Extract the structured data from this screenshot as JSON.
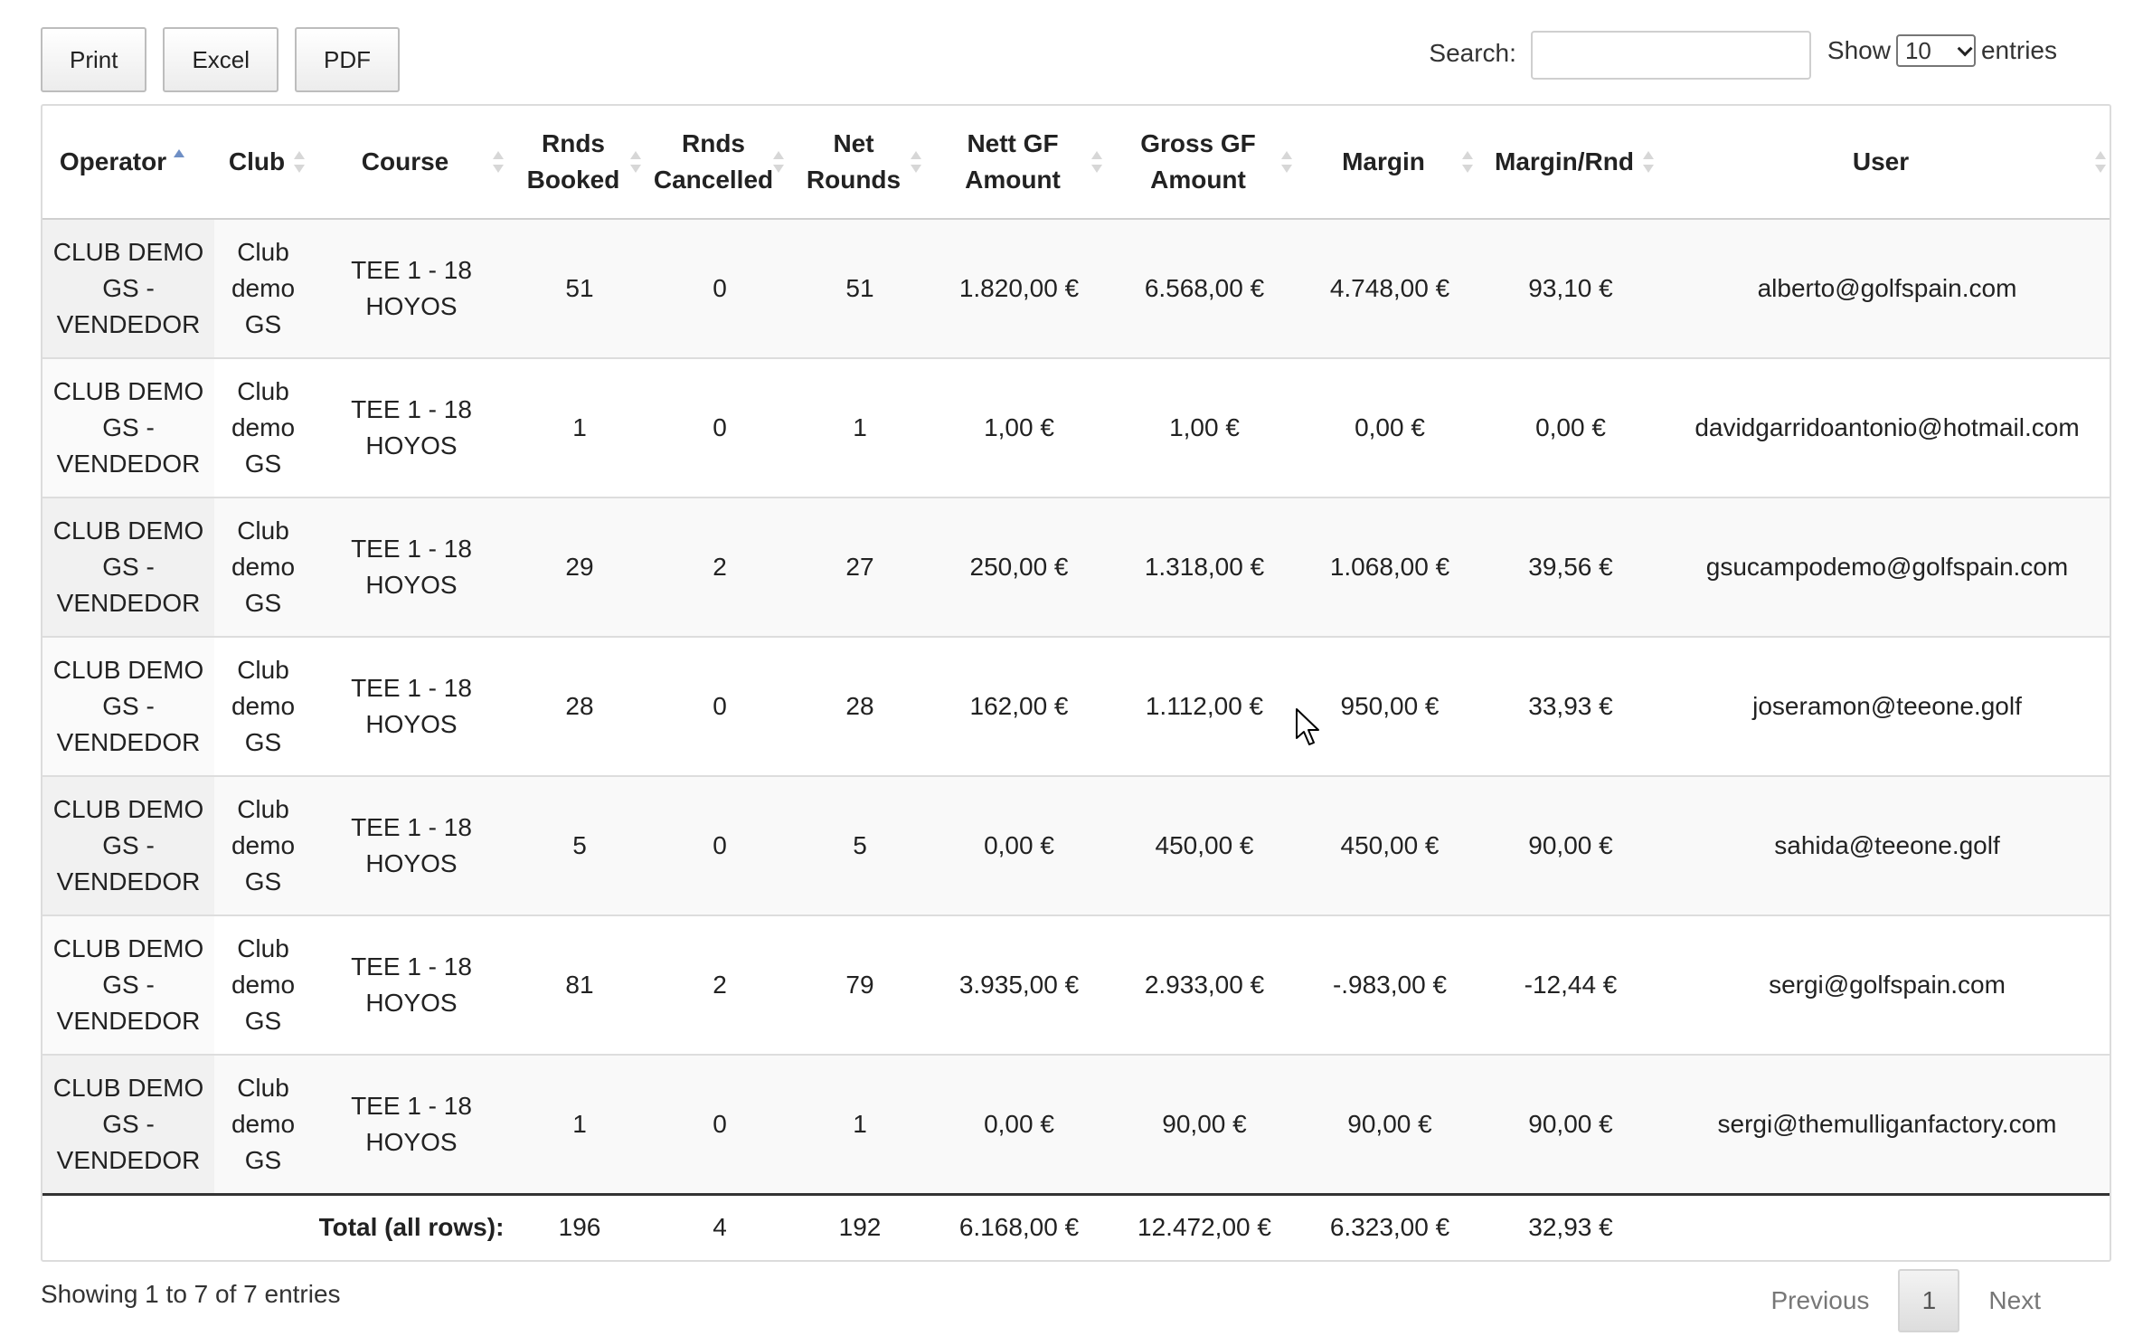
{
  "toolbar": {
    "print_label": "Print",
    "excel_label": "Excel",
    "pdf_label": "PDF"
  },
  "search": {
    "label": "Search:",
    "value": ""
  },
  "length": {
    "show_label": "Show",
    "selected": "10",
    "entries_label": "entries"
  },
  "columns": [
    "Operator",
    "Club",
    "Course",
    "Rnds Booked",
    "Rnds Cancelled",
    "Net Rounds",
    "Nett GF Amount",
    "Gross GF Amount",
    "Margin",
    "Margin/Rnd",
    "User"
  ],
  "header": {
    "operator": "Operator",
    "club": "Club",
    "course": "Course",
    "rnds_booked_1": "Rnds",
    "rnds_booked_2": "Booked",
    "rnds_cancelled_1": "Rnds",
    "rnds_cancelled_2": "Cancelled",
    "net_rounds_1": "Net",
    "net_rounds_2": "Rounds",
    "nett_gf_1": "Nett GF",
    "nett_gf_2": "Amount",
    "gross_gf_1": "Gross GF",
    "gross_gf_2": "Amount",
    "margin": "Margin",
    "margin_rnd": "Margin/Rnd",
    "user": "User"
  },
  "rows": [
    {
      "operator": "CLUB DEMO GS - VENDEDOR",
      "club": "Club demo GS",
      "course": "TEE 1 - 18 HOYOS",
      "booked": "51",
      "cancelled": "0",
      "net": "51",
      "nett_gf": "1.820,00 €",
      "gross_gf": "6.568,00 €",
      "margin": "4.748,00 €",
      "margin_rnd": "93,10 €",
      "user": "alberto@golfspain.com"
    },
    {
      "operator": "CLUB DEMO GS - VENDEDOR",
      "club": "Club demo GS",
      "course": "TEE 1 - 18 HOYOS",
      "booked": "1",
      "cancelled": "0",
      "net": "1",
      "nett_gf": "1,00 €",
      "gross_gf": "1,00 €",
      "margin": "0,00 €",
      "margin_rnd": "0,00 €",
      "user": "davidgarridoantonio@hotmail.com"
    },
    {
      "operator": "CLUB DEMO GS - VENDEDOR",
      "club": "Club demo GS",
      "course": "TEE 1 - 18 HOYOS",
      "booked": "29",
      "cancelled": "2",
      "net": "27",
      "nett_gf": "250,00 €",
      "gross_gf": "1.318,00 €",
      "margin": "1.068,00 €",
      "margin_rnd": "39,56 €",
      "user": "gsucampodemo@golfspain.com"
    },
    {
      "operator": "CLUB DEMO GS - VENDEDOR",
      "club": "Club demo GS",
      "course": "TEE 1 - 18 HOYOS",
      "booked": "28",
      "cancelled": "0",
      "net": "28",
      "nett_gf": "162,00 €",
      "gross_gf": "1.112,00 €",
      "margin": "950,00 €",
      "margin_rnd": "33,93 €",
      "user": "joseramon@teeone.golf"
    },
    {
      "operator": "CLUB DEMO GS - VENDEDOR",
      "club": "Club demo GS",
      "course": "TEE 1 - 18 HOYOS",
      "booked": "5",
      "cancelled": "0",
      "net": "5",
      "nett_gf": "0,00 €",
      "gross_gf": "450,00 €",
      "margin": "450,00 €",
      "margin_rnd": "90,00 €",
      "user": "sahida@teeone.golf"
    },
    {
      "operator": "CLUB DEMO GS - VENDEDOR",
      "club": "Club demo GS",
      "course": "TEE 1 - 18 HOYOS",
      "booked": "81",
      "cancelled": "2",
      "net": "79",
      "nett_gf": "3.935,00 €",
      "gross_gf": "2.933,00 €",
      "margin": "-.983,00 €",
      "margin_rnd": "-12,44 €",
      "user": "sergi@golfspain.com"
    },
    {
      "operator": "CLUB DEMO GS - VENDEDOR",
      "club": "Club demo GS",
      "course": "TEE 1 - 18 HOYOS",
      "booked": "1",
      "cancelled": "0",
      "net": "1",
      "nett_gf": "0,00 €",
      "gross_gf": "90,00 €",
      "margin": "90,00 €",
      "margin_rnd": "90,00 €",
      "user": "sergi@themulliganfactory.com"
    }
  ],
  "totals": {
    "label": "Total (all rows):",
    "booked": "196",
    "cancelled": "4",
    "net": "192",
    "nett_gf": "6.168,00 €",
    "gross_gf": "12.472,00 €",
    "margin": "6.323,00 €",
    "margin_rnd": "32,93 €"
  },
  "info": "Showing 1 to 7 of 7 entries",
  "pagination": {
    "previous": "Previous",
    "current": "1",
    "next": "Next"
  },
  "icons": {
    "sort_asc": "sort-asc-icon",
    "sort_both": "sort-both-icon",
    "select_chevron": "chevron-down-icon",
    "cursor": "mouse-pointer-icon"
  },
  "colors": {
    "sort_active": "#6f8fc5",
    "row_stripe": "#f9f9f9"
  }
}
